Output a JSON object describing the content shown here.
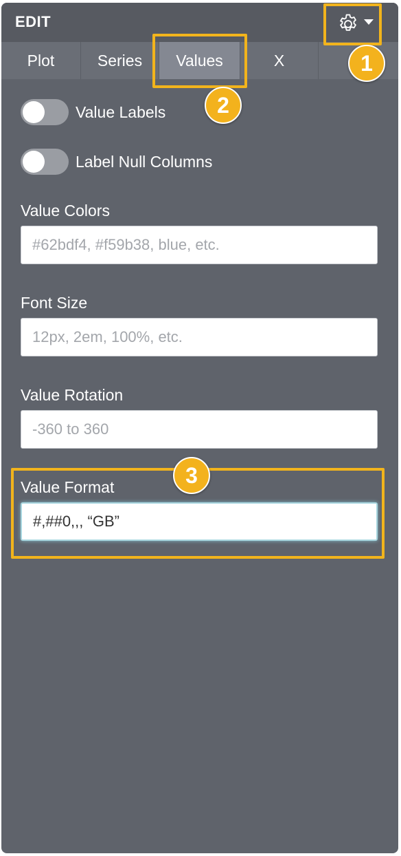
{
  "header": {
    "title": "EDIT"
  },
  "tabs": [
    {
      "label": "Plot",
      "active": false
    },
    {
      "label": "Series",
      "active": false
    },
    {
      "label": "Values",
      "active": true
    },
    {
      "label": "X",
      "active": false
    }
  ],
  "toggles": [
    {
      "label": "Value Labels",
      "on": false
    },
    {
      "label": "Label Null Columns",
      "on": false
    }
  ],
  "fields": [
    {
      "label": "Value Colors",
      "placeholder": "#62bdf4, #f59b38, blue, etc.",
      "value": ""
    },
    {
      "label": "Font Size",
      "placeholder": "12px, 2em, 100%, etc.",
      "value": ""
    },
    {
      "label": "Value Rotation",
      "placeholder": "-360 to 360",
      "value": ""
    },
    {
      "label": "Value Format",
      "placeholder": "",
      "value": "#,##0,,, “GB”"
    }
  ],
  "callouts": {
    "one": "1",
    "two": "2",
    "three": "3"
  },
  "colors": {
    "highlight": "#f2b41c",
    "panel": "#5f636b",
    "header": "#575a61",
    "active_tab": "#848892"
  },
  "icons": {
    "settings": "gear-icon",
    "dropdown": "caret-down-icon"
  }
}
